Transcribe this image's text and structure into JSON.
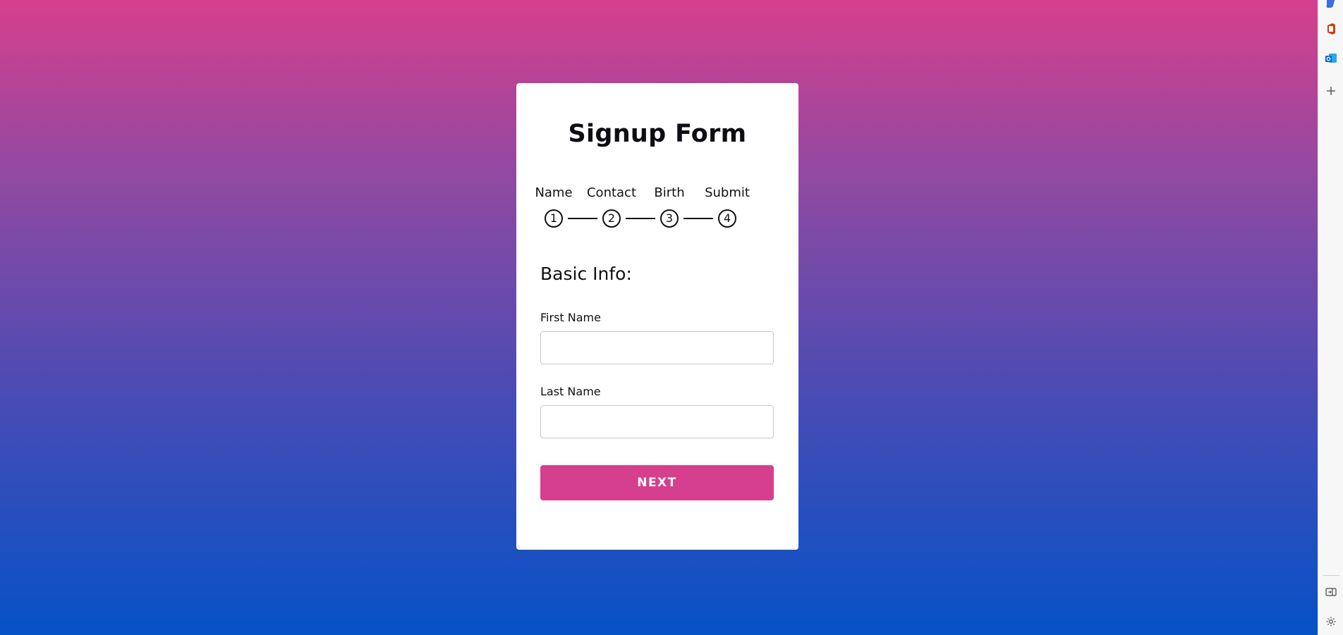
{
  "form": {
    "title": "Signup Form",
    "steps": [
      {
        "label": "Name",
        "number": "1"
      },
      {
        "label": "Contact",
        "number": "2"
      },
      {
        "label": "Birth",
        "number": "3"
      },
      {
        "label": "Submit",
        "number": "4"
      }
    ],
    "section_title": "Basic Info:",
    "fields": [
      {
        "label": "First Name",
        "value": ""
      },
      {
        "label": "Last Name",
        "value": ""
      }
    ],
    "next_label": "NEXT"
  },
  "sidebar": {
    "icons": [
      "copilot-icon",
      "office-icon",
      "outlook-icon",
      "add-icon",
      "sidebar-toggle-icon",
      "settings-icon"
    ]
  },
  "colors": {
    "gradient_top": "#d63f8d",
    "gradient_bottom": "#0552c7",
    "accent": "#d63f8d"
  }
}
